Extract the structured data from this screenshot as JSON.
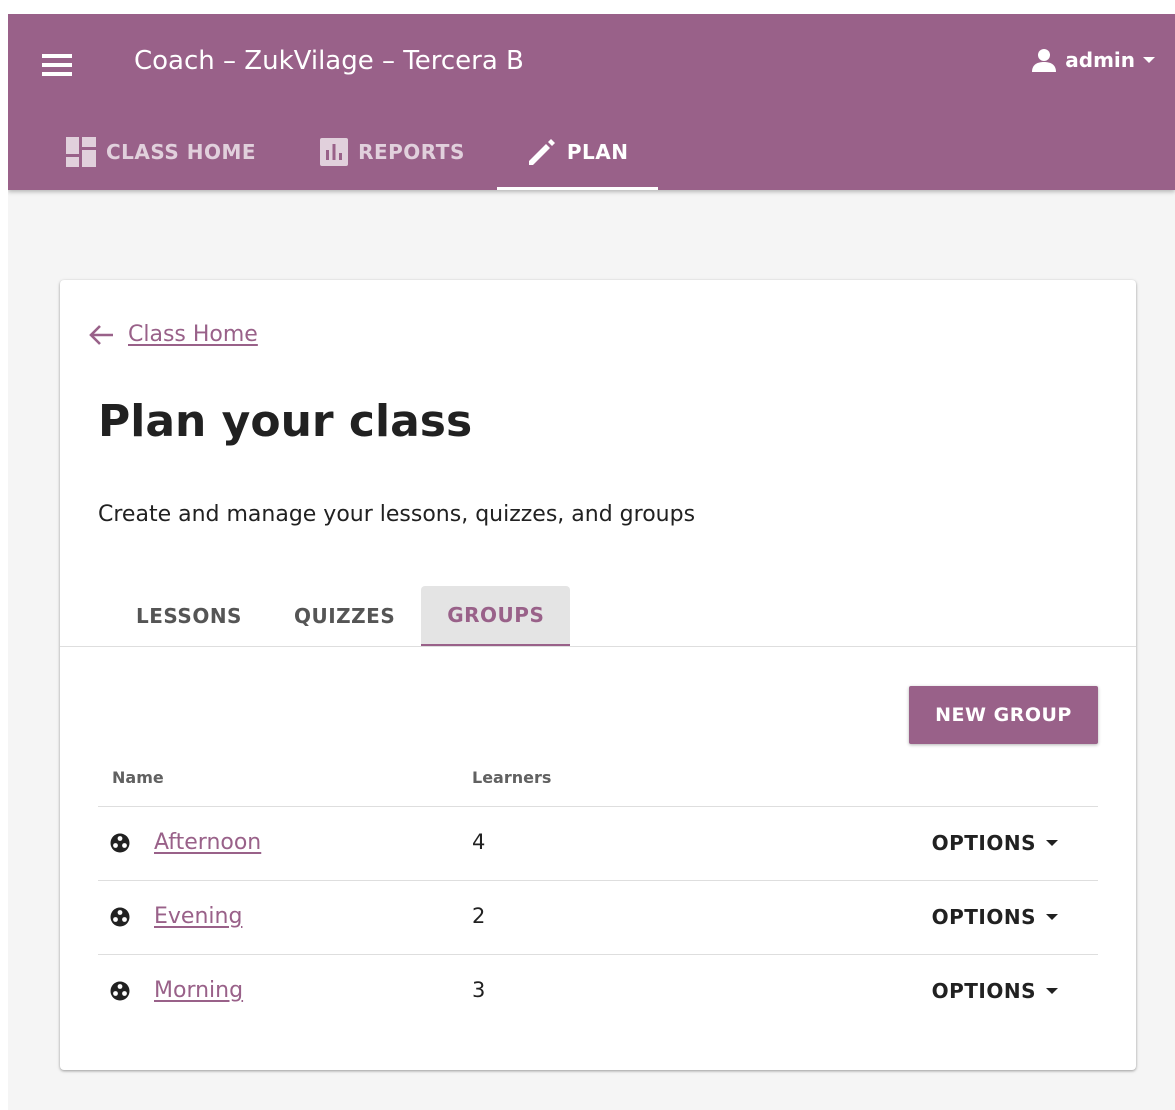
{
  "colors": {
    "brand": "#996189",
    "active_tab_bg": "#e4e4e4",
    "page_bg": "#f5f5f5"
  },
  "header": {
    "title": "Coach – ZukVilage – Tercera B",
    "user_label": "admin",
    "menu_icon": "menu-icon",
    "user_icon": "person-icon"
  },
  "nav": {
    "tabs": [
      {
        "label": "CLASS HOME",
        "icon": "dashboard-icon",
        "active": false
      },
      {
        "label": "REPORTS",
        "icon": "bar-chart-icon",
        "active": false
      },
      {
        "label": "PLAN",
        "icon": "pencil-icon",
        "active": true
      }
    ]
  },
  "main": {
    "back_link": "Class Home",
    "title": "Plan your class",
    "subtitle": "Create and manage your lessons, quizzes, and groups",
    "tabs": [
      {
        "label": "LESSONS",
        "active": false
      },
      {
        "label": "QUIZZES",
        "active": false
      },
      {
        "label": "GROUPS",
        "active": true
      }
    ],
    "new_group_button": "NEW GROUP",
    "table": {
      "headers": {
        "name": "Name",
        "learners": "Learners"
      },
      "rows": [
        {
          "name": "Afternoon",
          "learners": "4",
          "options": "OPTIONS"
        },
        {
          "name": "Evening",
          "learners": "2",
          "options": "OPTIONS"
        },
        {
          "name": "Morning",
          "learners": "3",
          "options": "OPTIONS"
        }
      ]
    }
  }
}
